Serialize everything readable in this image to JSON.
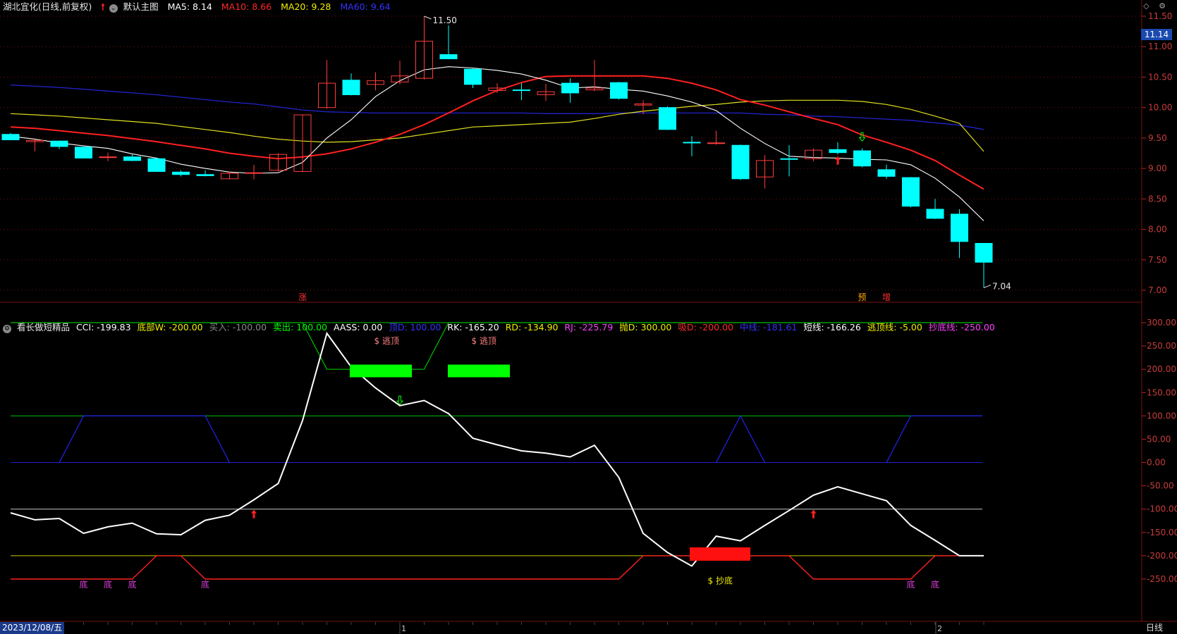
{
  "header": {
    "stock": "湖北宜化(日线,前复权)",
    "main_chart_label": "默认主图",
    "ma": [
      {
        "label": "MA5: 8.14",
        "color": "#ffffff"
      },
      {
        "label": "MA10: 8.66",
        "color": "#ff2a2a"
      },
      {
        "label": "MA20: 9.28",
        "color": "#f0f000"
      },
      {
        "label": "MA60: 9.64",
        "color": "#3333ff"
      }
    ]
  },
  "indicator": {
    "name": "看长做短精品",
    "fields": [
      {
        "label": "CCI: -199.83",
        "color": "#ffffff"
      },
      {
        "label": "底部W: -200.00",
        "color": "#f0f000"
      },
      {
        "label": "买入: -100.00",
        "color": "#888888"
      },
      {
        "label": "卖出: 100.00",
        "color": "#00ff00"
      },
      {
        "label": "AASS: 0.00",
        "color": "#ffffff"
      },
      {
        "label": "顶D: 100.00",
        "color": "#3333ff"
      },
      {
        "label": "RK: -165.20",
        "color": "#ffffff"
      },
      {
        "label": "RD: -134.90",
        "color": "#f0f000"
      },
      {
        "label": "RJ: -225.79",
        "color": "#ff40ff"
      },
      {
        "label": "抛D: 300.00",
        "color": "#f0f000"
      },
      {
        "label": "吸D: -200.00",
        "color": "#ff2a2a"
      },
      {
        "label": "中线: -181.61",
        "color": "#3333ff"
      },
      {
        "label": "短线: -166.26",
        "color": "#ffffff"
      },
      {
        "label": "逃顶线: -5.00",
        "color": "#f0f000"
      },
      {
        "label": "抄底线: -250.00",
        "color": "#ff40ff"
      }
    ]
  },
  "price_axis": {
    "ticks": [
      "11.50",
      "11.00",
      "10.50",
      "10.00",
      "9.50",
      "9.00",
      "8.50",
      "8.00",
      "7.50",
      "7.00"
    ],
    "current_price": "11.14"
  },
  "indicator_axis": {
    "ticks": [
      "300.00",
      "250.00",
      "200.00",
      "150.00",
      "100.00",
      "50.00",
      "0.00",
      "-50.00",
      "-100.00",
      "-150.00",
      "-200.00",
      "-250.00"
    ]
  },
  "annotations": {
    "high": "11.50",
    "low": "7.04",
    "zhang": "涨",
    "yu": "预",
    "zeng": "增",
    "escape_top": "$ 逃顶",
    "buy_bottom": "$ 抄底",
    "di": "底",
    "month_1": "1",
    "month_2": "2"
  },
  "bottom": {
    "date": "2023/12/08/五",
    "period": "日线"
  },
  "colors": {
    "up": "#ff3c3c",
    "down": "#00ffff",
    "ma5": "#ffffff",
    "ma10": "#ff2020",
    "ma20": "#e0e020",
    "ma60": "#2222cc",
    "grid": "#7a1010"
  },
  "chart_data": {
    "type": "candlestick",
    "candles": [
      [
        9.56,
        9.47,
        9.58,
        9.47
      ],
      [
        9.44,
        9.46,
        9.48,
        9.28
      ],
      [
        9.45,
        9.36,
        9.46,
        9.32
      ],
      [
        9.35,
        9.17,
        9.36,
        9.17
      ],
      [
        9.18,
        9.19,
        9.26,
        9.12
      ],
      [
        9.19,
        9.13,
        9.24,
        9.12
      ],
      [
        9.16,
        8.95,
        9.17,
        8.95
      ],
      [
        8.94,
        8.9,
        8.97,
        8.87
      ],
      [
        8.9,
        8.88,
        8.97,
        8.87
      ],
      [
        8.83,
        8.92,
        8.95,
        8.82
      ],
      [
        8.93,
        8.93,
        9.06,
        8.82
      ],
      [
        8.97,
        9.23,
        9.25,
        8.95
      ],
      [
        8.95,
        9.88,
        9.88,
        8.94
      ],
      [
        10.0,
        10.4,
        10.78,
        9.98
      ],
      [
        10.45,
        10.21,
        10.56,
        10.2
      ],
      [
        10.38,
        10.44,
        10.58,
        10.28
      ],
      [
        10.42,
        10.52,
        10.77,
        10.38
      ],
      [
        10.48,
        11.09,
        11.5,
        10.46
      ],
      [
        10.87,
        10.8,
        11.35,
        10.79
      ],
      [
        10.63,
        10.38,
        10.65,
        10.32
      ],
      [
        10.28,
        10.32,
        10.4,
        10.24
      ],
      [
        10.29,
        10.28,
        10.4,
        10.12
      ],
      [
        10.21,
        10.26,
        10.39,
        10.11
      ],
      [
        10.4,
        10.24,
        10.48,
        10.08
      ],
      [
        10.29,
        10.32,
        10.78,
        10.27
      ],
      [
        10.41,
        10.15,
        10.42,
        10.13
      ],
      [
        10.04,
        10.06,
        10.12,
        9.89
      ],
      [
        10.0,
        9.64,
        10.02,
        9.63
      ],
      [
        9.43,
        9.42,
        9.53,
        9.2
      ],
      [
        9.42,
        9.42,
        9.62,
        9.39
      ],
      [
        9.38,
        8.83,
        9.39,
        8.81
      ],
      [
        8.86,
        9.13,
        9.22,
        8.67
      ],
      [
        9.16,
        9.15,
        9.38,
        8.87
      ],
      [
        9.16,
        9.3,
        9.33,
        9.12
      ],
      [
        9.31,
        9.26,
        9.43,
        9.23
      ],
      [
        9.29,
        9.04,
        9.33,
        9.02
      ],
      [
        8.98,
        8.87,
        9.06,
        8.83
      ],
      [
        8.85,
        8.38,
        8.86,
        8.36
      ],
      [
        8.33,
        8.18,
        8.5,
        8.17
      ],
      [
        8.25,
        7.8,
        8.33,
        7.53
      ],
      [
        7.77,
        7.46,
        7.77,
        7.04
      ]
    ],
    "ma5": [
      9.53,
      9.48,
      9.42,
      9.37,
      9.33,
      9.24,
      9.17,
      9.07,
      9.0,
      8.94,
      8.92,
      8.93,
      9.1,
      9.5,
      9.8,
      10.18,
      10.44,
      10.62,
      10.67,
      10.65,
      10.61,
      10.55,
      10.45,
      10.32,
      10.34,
      10.3,
      10.27,
      10.19,
      10.09,
      9.95,
      9.66,
      9.41,
      9.2,
      9.18,
      9.17,
      9.15,
      9.14,
      9.06,
      8.84,
      8.53,
      8.14
    ],
    "ma10": [
      9.68,
      9.66,
      9.62,
      9.58,
      9.54,
      9.49,
      9.44,
      9.38,
      9.32,
      9.25,
      9.2,
      9.16,
      9.19,
      9.24,
      9.32,
      9.43,
      9.56,
      9.72,
      9.91,
      10.11,
      10.28,
      10.41,
      10.51,
      10.52,
      10.52,
      10.52,
      10.52,
      10.48,
      10.4,
      10.29,
      10.13,
      10.04,
      9.93,
      9.82,
      9.72,
      9.55,
      9.43,
      9.3,
      9.13,
      8.89,
      8.66
    ],
    "ma20": [
      9.9,
      9.88,
      9.86,
      9.83,
      9.8,
      9.77,
      9.74,
      9.69,
      9.64,
      9.59,
      9.53,
      9.48,
      9.45,
      9.43,
      9.44,
      9.47,
      9.5,
      9.56,
      9.62,
      9.68,
      9.7,
      9.72,
      9.74,
      9.76,
      9.82,
      9.89,
      9.94,
      9.98,
      10.02,
      10.05,
      10.09,
      10.11,
      10.12,
      10.12,
      10.12,
      10.1,
      10.05,
      9.97,
      9.86,
      9.74,
      9.28
    ],
    "ma60": [
      10.37,
      10.35,
      10.33,
      10.3,
      10.27,
      10.24,
      10.21,
      10.17,
      10.13,
      10.09,
      10.06,
      10.01,
      9.96,
      9.93,
      9.92,
      9.91,
      9.91,
      9.91,
      9.91,
      9.91,
      9.91,
      9.91,
      9.9,
      9.9,
      9.9,
      9.91,
      9.91,
      9.91,
      9.91,
      9.91,
      9.91,
      9.89,
      9.88,
      9.86,
      9.85,
      9.83,
      9.81,
      9.79,
      9.75,
      9.71,
      9.64
    ],
    "cci": [
      -108,
      -123,
      -120,
      -152,
      -138,
      -130,
      -153,
      -155,
      -124,
      -113,
      -80,
      -45,
      90,
      277,
      205,
      160,
      122,
      133,
      105,
      52,
      38,
      25,
      20,
      12,
      37,
      -32,
      -152,
      -193,
      -222,
      -158,
      -168,
      -135,
      -103,
      -70,
      -52,
      -67,
      -82,
      -135,
      -167,
      -200,
      -200
    ],
    "xlim": [
      0,
      40
    ],
    "price_ylim": [
      7.04,
      11.5
    ],
    "cci_ylim": [
      -250,
      300
    ]
  }
}
